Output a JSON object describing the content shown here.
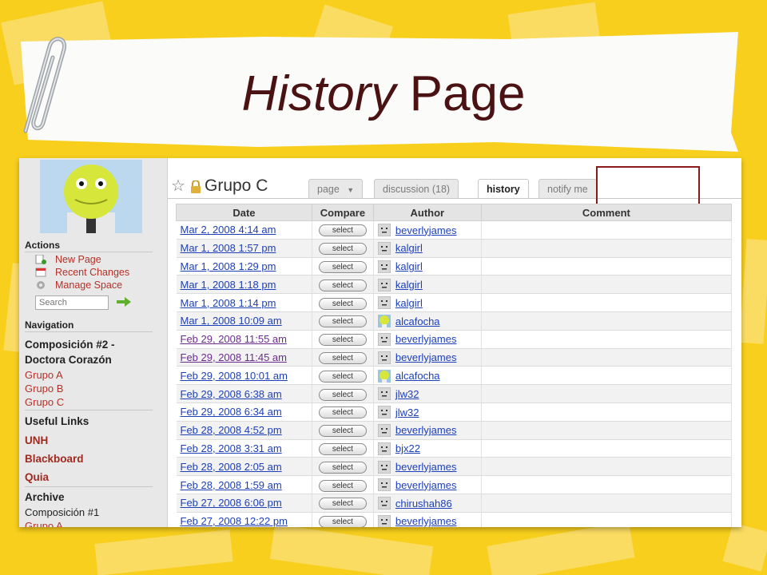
{
  "slide": {
    "title_italic": "History",
    "title_rest": "Page"
  },
  "sidebar": {
    "actions_heading": "Actions",
    "actions": [
      "New Page",
      "Recent Changes",
      "Manage Space"
    ],
    "search_placeholder": "Search",
    "navigation_heading": "Navigation",
    "nav_title_line1": "Composición #2 -",
    "nav_title_line2": "Doctora Corazón",
    "nav_groups": [
      "Grupo A",
      "Grupo B",
      "Grupo C"
    ],
    "useful_links_heading": "Useful Links",
    "useful_links": [
      "UNH",
      "Blackboard",
      "Quia"
    ],
    "archive_heading": "Archive",
    "archive_items": [
      "Composición #1",
      "Grupo A"
    ]
  },
  "page": {
    "title": "Grupo C",
    "tabs": [
      "page",
      "discussion (18)",
      "history",
      "notify me"
    ],
    "active_tab": "history"
  },
  "history_table": {
    "columns": [
      "Date",
      "Compare",
      "Author",
      "Comment"
    ],
    "select_label": "select",
    "rows": [
      {
        "date": "Mar 2, 2008 4:14 am",
        "author": "beverlyjames",
        "photo": false
      },
      {
        "date": "Mar 1, 2008 1:57 pm",
        "author": "kalgirl",
        "photo": false
      },
      {
        "date": "Mar 1, 2008 1:29 pm",
        "author": "kalgirl",
        "photo": false
      },
      {
        "date": "Mar 1, 2008 1:18 pm",
        "author": "kalgirl",
        "photo": false
      },
      {
        "date": "Mar 1, 2008 1:14 pm",
        "author": "kalgirl",
        "photo": false
      },
      {
        "date": "Mar 1, 2008 10:09 am",
        "author": "alcafocha",
        "photo": true
      },
      {
        "date": "Feb 29, 2008 11:55 am",
        "author": "beverlyjames",
        "photo": false
      },
      {
        "date": "Feb 29, 2008 11:45 am",
        "author": "beverlyjames",
        "photo": false
      },
      {
        "date": "Feb 29, 2008 10:01 am",
        "author": "alcafocha",
        "photo": true
      },
      {
        "date": "Feb 29, 2008 6:38 am",
        "author": "jlw32",
        "photo": false
      },
      {
        "date": "Feb 29, 2008 6:34 am",
        "author": "jlw32",
        "photo": false
      },
      {
        "date": "Feb 28, 2008 4:52 pm",
        "author": "beverlyjames",
        "photo": false
      },
      {
        "date": "Feb 28, 2008 3:31 am",
        "author": "bjx22",
        "photo": false
      },
      {
        "date": "Feb 28, 2008 2:05 am",
        "author": "beverlyjames",
        "photo": false
      },
      {
        "date": "Feb 28, 2008 1:59 am",
        "author": "beverlyjames",
        "photo": false
      },
      {
        "date": "Feb 27, 2008 6:06 pm",
        "author": "chirushah86",
        "photo": false
      },
      {
        "date": "Feb 27, 2008 12:22 pm",
        "author": "beverlyjames",
        "photo": false
      }
    ]
  }
}
